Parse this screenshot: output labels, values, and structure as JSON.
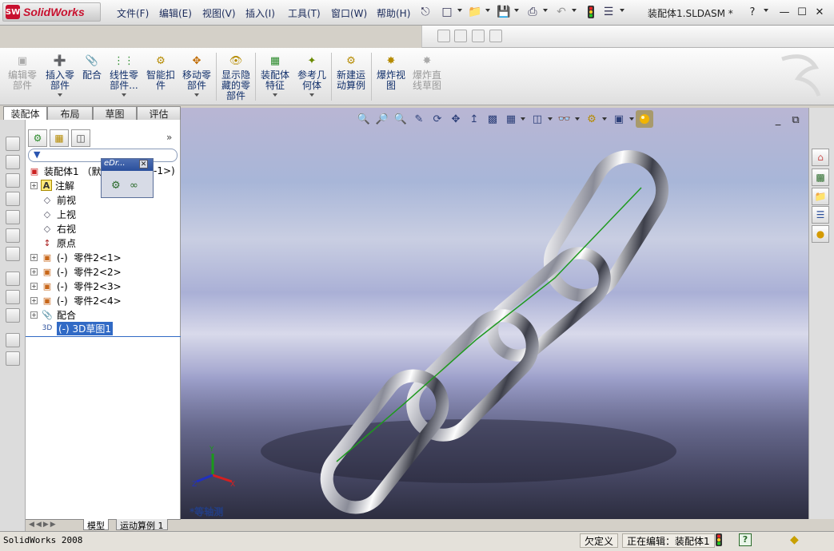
{
  "app": {
    "logo_text": "SolidWorks",
    "document_title": "装配体1.SLDASM *"
  },
  "menu": [
    "文件(F)",
    "编辑(E)",
    "视图(V)",
    "插入(I)",
    "工具(T)",
    "窗口(W)",
    "帮助(H)"
  ],
  "window_controls": {
    "help": "?",
    "minimize": "—",
    "maximize": "☐",
    "close": "✕"
  },
  "commands": [
    {
      "label": "编辑零\n部件",
      "icon": "edit-component-icon",
      "enabled": false
    },
    {
      "label": "插入零\n部件",
      "icon": "insert-component-icon",
      "enabled": true
    },
    {
      "label": "配合",
      "icon": "mate-icon",
      "enabled": true
    },
    {
      "label": "线性零\n部件...",
      "icon": "linear-pattern-icon",
      "enabled": true
    },
    {
      "label": "智能扣\n件",
      "icon": "smart-fastener-icon",
      "enabled": true
    },
    {
      "label": "移动零\n部件",
      "icon": "move-component-icon",
      "enabled": true
    },
    {
      "label": "显示隐\n藏的零\n部件",
      "icon": "show-hidden-icon",
      "enabled": true
    },
    {
      "label": "装配体\n特征",
      "icon": "assembly-feature-icon",
      "enabled": true
    },
    {
      "label": "参考几\n何体",
      "icon": "reference-geometry-icon",
      "enabled": true
    },
    {
      "label": "新建运\n动算例",
      "icon": "motion-study-icon",
      "enabled": true
    },
    {
      "label": "爆炸视\n图",
      "icon": "exploded-view-icon",
      "enabled": true
    },
    {
      "label": "爆炸直\n线草图",
      "icon": "explode-line-sketch-icon",
      "enabled": false
    }
  ],
  "tabs": [
    "装配体",
    "布局",
    "草图",
    "评估"
  ],
  "tree": {
    "root": "装配体1 （默",
    "root_tail": "-1>)",
    "items": [
      {
        "label": "注解",
        "expandable": true
      },
      {
        "label": "前视",
        "expandable": false
      },
      {
        "label": "上视",
        "expandable": false
      },
      {
        "label": "右视",
        "expandable": false
      },
      {
        "label": "原点",
        "expandable": false
      },
      {
        "label": "(-)  零件2<1>",
        "expandable": true
      },
      {
        "label": "(-)  零件2<2>",
        "expandable": true
      },
      {
        "label": "(-)  零件2<3>",
        "expandable": true
      },
      {
        "label": "(-)  零件2<4>",
        "expandable": true
      },
      {
        "label": "配合",
        "expandable": true
      },
      {
        "label": "(-) 3D草图1",
        "expandable": false,
        "selected": true
      }
    ]
  },
  "ebar": {
    "title": "eDr..."
  },
  "panel_bottom_tabs": [
    "模型",
    "运动算例 1"
  ],
  "viewport": {
    "view_name": "*等轴测"
  },
  "statusbar": {
    "app_version": "SolidWorks 2008",
    "define_state": "欠定义",
    "editing": "正在编辑：装配体1"
  }
}
